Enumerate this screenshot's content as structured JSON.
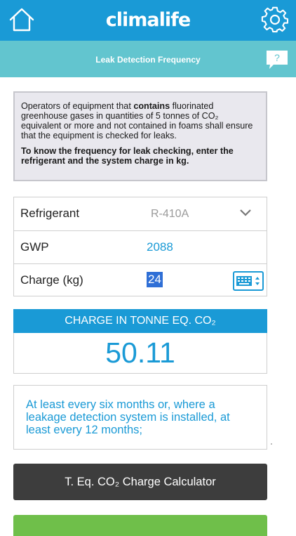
{
  "header": {
    "logo": "climalife",
    "subtitle": "Leak Detection Frequency",
    "help_label": "?"
  },
  "info": {
    "paragraph1_before": "Operators of equipment that ",
    "paragraph1_bold": "contains",
    "paragraph1_after": " fluorinated greenhouse gases in quantities of 5 tonnes of CO₂ equivalent or more and not contained in foams shall ensure that the equipment is checked for leaks.",
    "paragraph2": "To know the frequency for leak checking, enter the refrigerant and the system charge in kg."
  },
  "form": {
    "refrigerant_label": "Refrigerant",
    "refrigerant_value": "R-410A",
    "gwp_label": "GWP",
    "gwp_value": "2088",
    "charge_label": "Charge (kg)",
    "charge_value": "24"
  },
  "result": {
    "header": "CHARGE IN TONNE EQ. CO₂",
    "value": "50.11"
  },
  "frequency_text": "At least every six months or, where a leakage detection system is installed, at least every 12 months;",
  "buttons": {
    "calculator": "T. Eq. CO₂ Charge Calculator"
  },
  "colors": {
    "brand_blue": "#1a9ad6",
    "subbar_teal": "#62c5cf",
    "dark_button": "#3d3d3d",
    "green_button": "#6fbf4a"
  },
  "icons": {
    "home": "home-icon",
    "settings": "gear-icon",
    "help": "help-bubble-icon",
    "dropdown": "chevron-down-icon",
    "keyboard": "keyboard-toggle-icon"
  }
}
